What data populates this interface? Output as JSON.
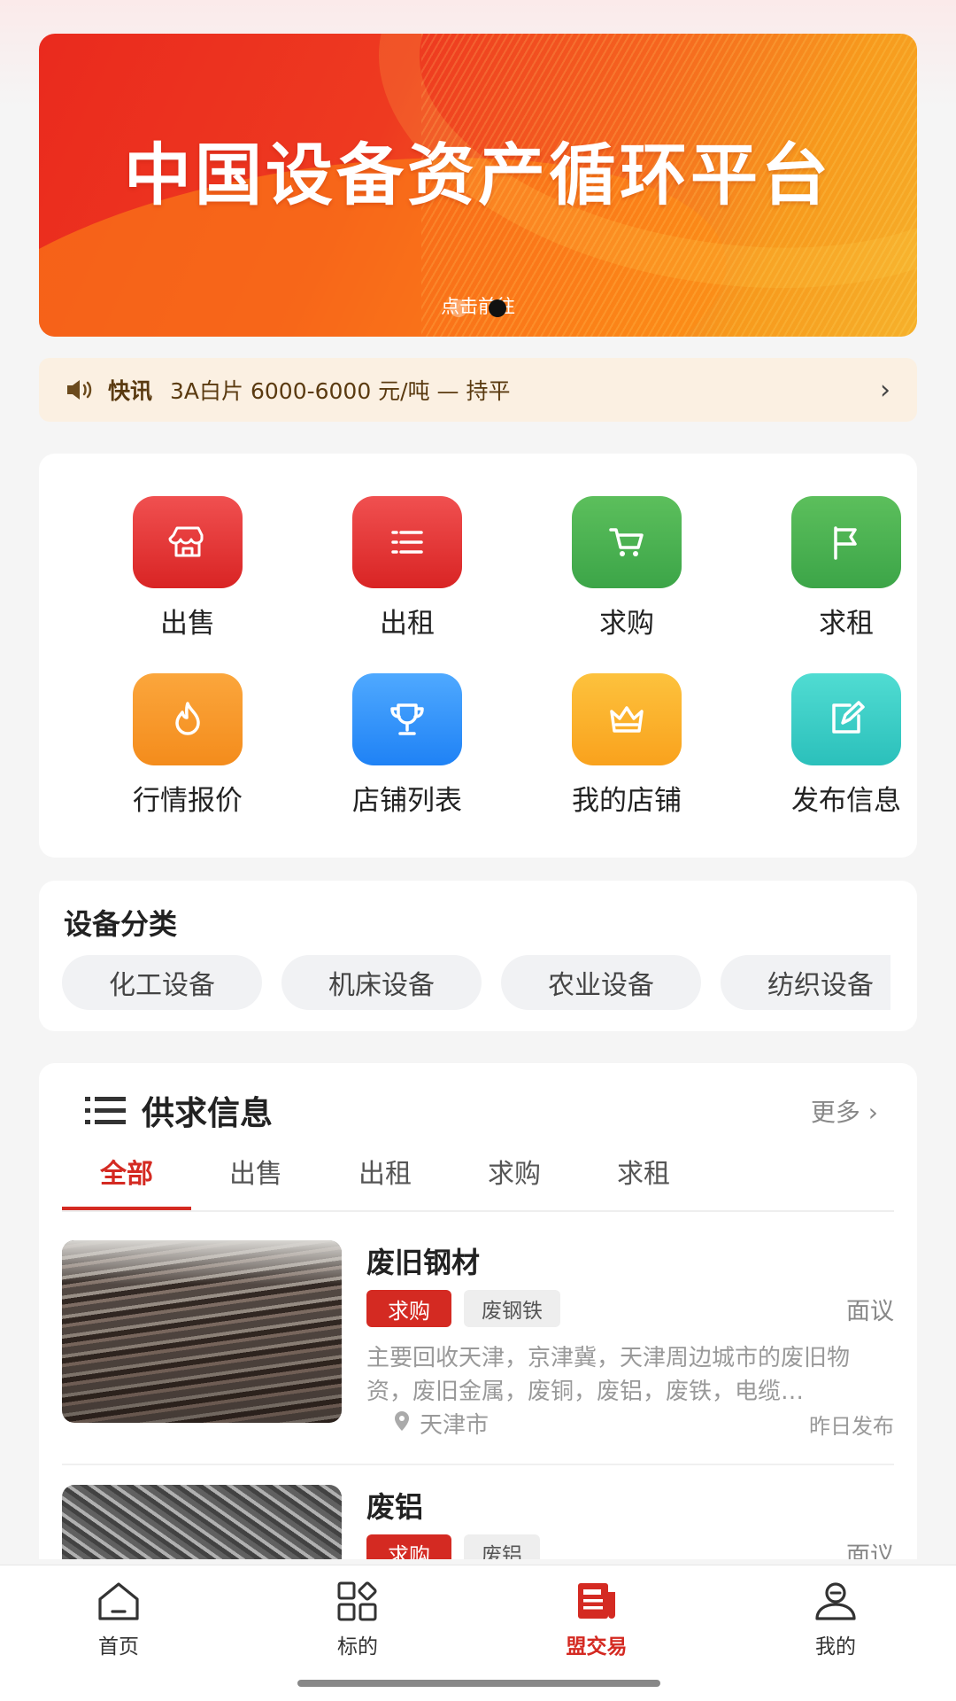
{
  "banner": {
    "title": "中国设备资产循环平台",
    "link": "点击前往"
  },
  "ticker": {
    "tag": "快讯",
    "text": "3A白片 6000-6000 元/吨 — 持平"
  },
  "grid": [
    {
      "label": "出售",
      "icon": "store-icon"
    },
    {
      "label": "出租",
      "icon": "list-icon"
    },
    {
      "label": "求购",
      "icon": "cart-icon"
    },
    {
      "label": "求租",
      "icon": "flag-icon"
    },
    {
      "label": "行情报价",
      "icon": "flame-icon"
    },
    {
      "label": "店铺列表",
      "icon": "trophy-icon"
    },
    {
      "label": "我的店铺",
      "icon": "crown-icon"
    },
    {
      "label": "发布信息",
      "icon": "edit-icon"
    }
  ],
  "categories": {
    "title": "设备分类",
    "items": [
      "化工设备",
      "机床设备",
      "农业设备",
      "纺织设备"
    ]
  },
  "supply": {
    "title": "供求信息",
    "more": "更多",
    "tabs": [
      "全部",
      "出售",
      "出租",
      "求购",
      "求租"
    ],
    "active_tab": "全部",
    "items": [
      {
        "title": "废旧钢材",
        "type": "求购",
        "tag": "废钢铁",
        "price": "面议",
        "desc": "主要回收天津，京津冀，天津周边城市的废旧物资，废旧金属，废铜，废铝，废铁，电缆…",
        "location": "天津市",
        "time": "昨日发布"
      },
      {
        "title": "废铝",
        "type": "求购",
        "tag": "废铝",
        "price": "面议"
      }
    ]
  },
  "nav": [
    {
      "label": "首页",
      "icon": "home-icon"
    },
    {
      "label": "标的",
      "icon": "grid-icon"
    },
    {
      "label": "盟交易",
      "icon": "news-icon",
      "active": true
    },
    {
      "label": "我的",
      "icon": "user-icon"
    }
  ],
  "colors": {
    "accent": "#d42a22",
    "ticker_bg": "#fbf0e2"
  }
}
